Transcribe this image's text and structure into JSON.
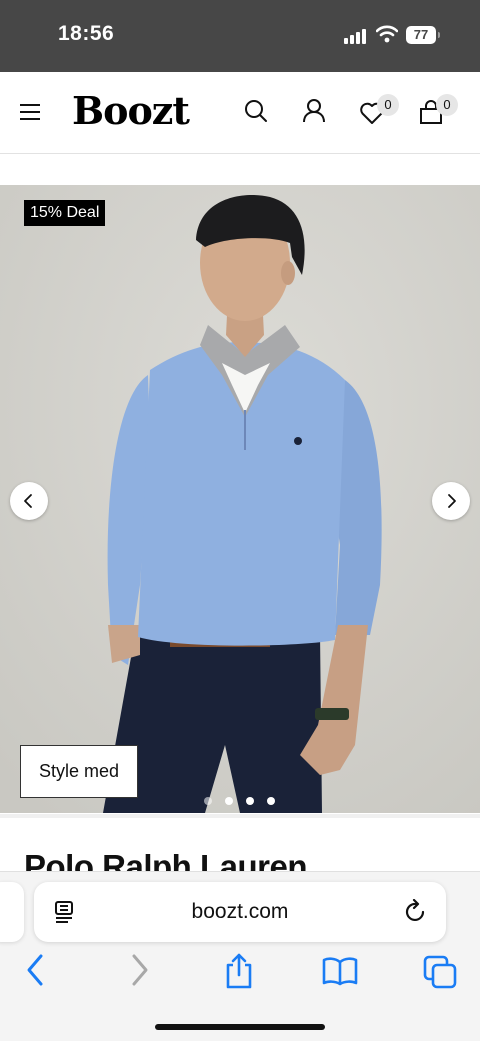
{
  "status": {
    "time": "18:56",
    "battery": "77"
  },
  "header": {
    "logo": "Boozt",
    "wishlist_count": "0",
    "cart_count": "0"
  },
  "product": {
    "deal_badge": "15% Deal",
    "style_button": "Style med",
    "brand": "Polo Ralph Lauren",
    "image_count": 4,
    "active_image": 1
  },
  "browser": {
    "url": "boozt.com"
  },
  "icons": {
    "menu": "hamburger-icon",
    "search": "search-icon",
    "account": "user-icon",
    "wishlist": "heart-icon",
    "cart": "bag-icon",
    "prev": "chevron-left-icon",
    "next": "chevron-right-icon",
    "reader": "reader-icon",
    "reload": "reload-icon",
    "back": "back-icon",
    "forward": "forward-icon",
    "share": "share-icon",
    "bookmarks": "bookmarks-icon",
    "tabs": "tabs-icon"
  },
  "colors": {
    "status_bar": "#474747",
    "safari_blue": "#1a7cf4",
    "sweater": "#8fb0e0",
    "trousers": "#1a2238"
  }
}
